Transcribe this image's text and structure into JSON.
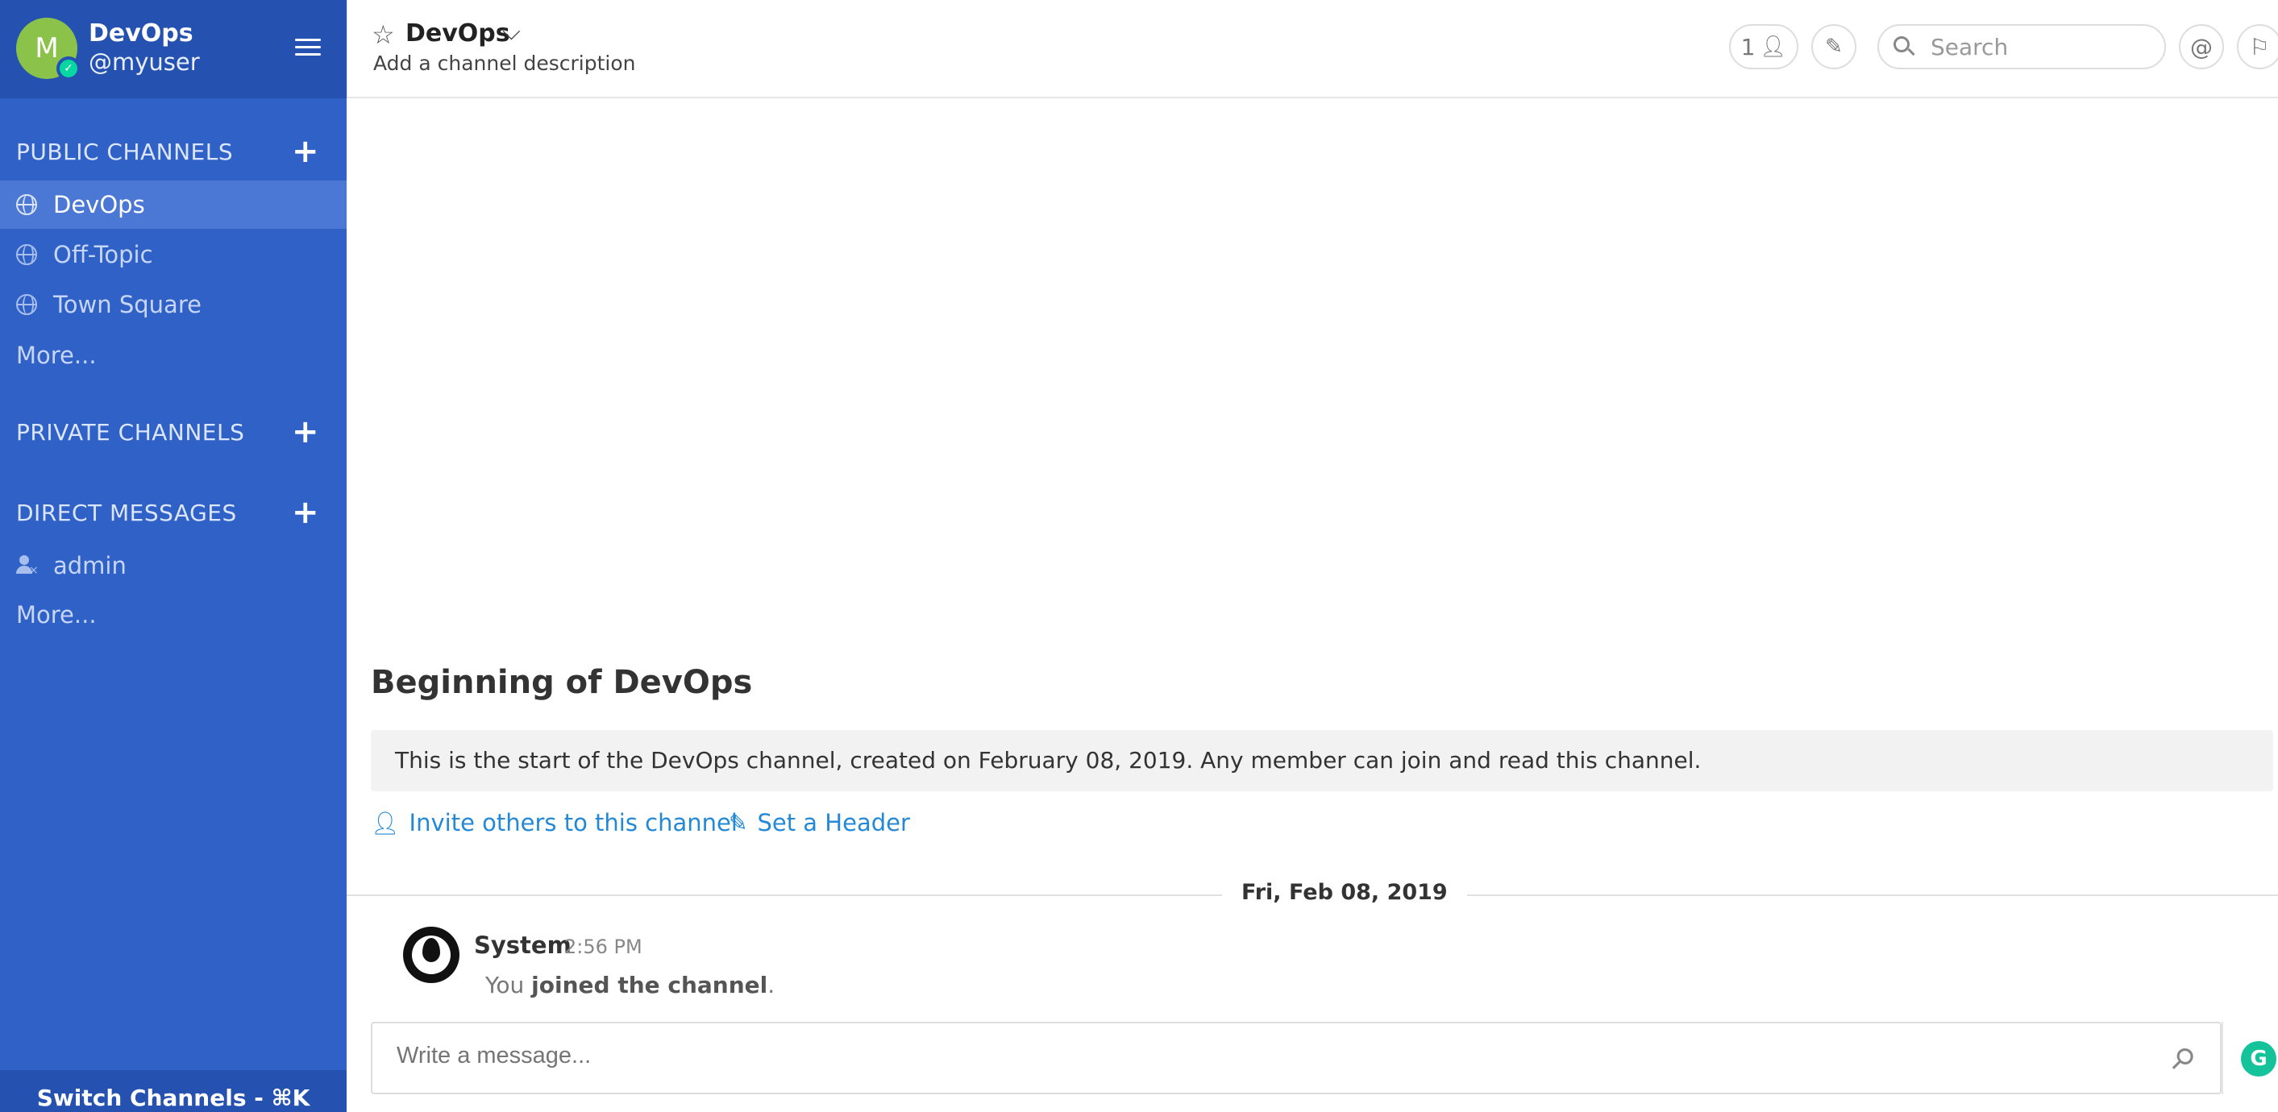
{
  "team": {
    "name": "DevOps",
    "username": "@myuser",
    "avatar_letter": "M"
  },
  "sidebar": {
    "public_channels_title": "PUBLIC CHANNELS",
    "public_channels": [
      {
        "label": "DevOps",
        "active": true
      },
      {
        "label": "Off-Topic",
        "active": false
      },
      {
        "label": "Town Square",
        "active": false
      }
    ],
    "public_more": "More...",
    "private_channels_title": "PRIVATE CHANNELS",
    "direct_messages_title": "DIRECT MESSAGES",
    "direct_messages": [
      {
        "label": "admin"
      }
    ],
    "dm_more": "More...",
    "switch_channels": "Switch Channels - ⌘K"
  },
  "header": {
    "channel_name": "DevOps",
    "description": "Add a channel description",
    "member_count": "1",
    "search_placeholder": "Search"
  },
  "main": {
    "intro_title": "Beginning of DevOps",
    "intro_text": "This is the start of the DevOps channel, created on February 08, 2019. Any member can join and read this channel.",
    "invite_link": "Invite others to this channel",
    "header_link": "Set a Header",
    "date_separator": "Fri, Feb 08, 2019",
    "post": {
      "author": "System",
      "time": "2:56 PM",
      "message_prefix": "You",
      "message_bold": "joined the channel",
      "message_suffix": "."
    },
    "composer_placeholder": "Write a message..."
  },
  "colors": {
    "sidebar_bg": "#2f61c6",
    "sidebar_header_bg": "#2552b0",
    "active_channel_bg": "#4a78d4",
    "link": "#2389d7",
    "avatar_bg": "#8bc34a",
    "online_status": "#06d6a0"
  }
}
